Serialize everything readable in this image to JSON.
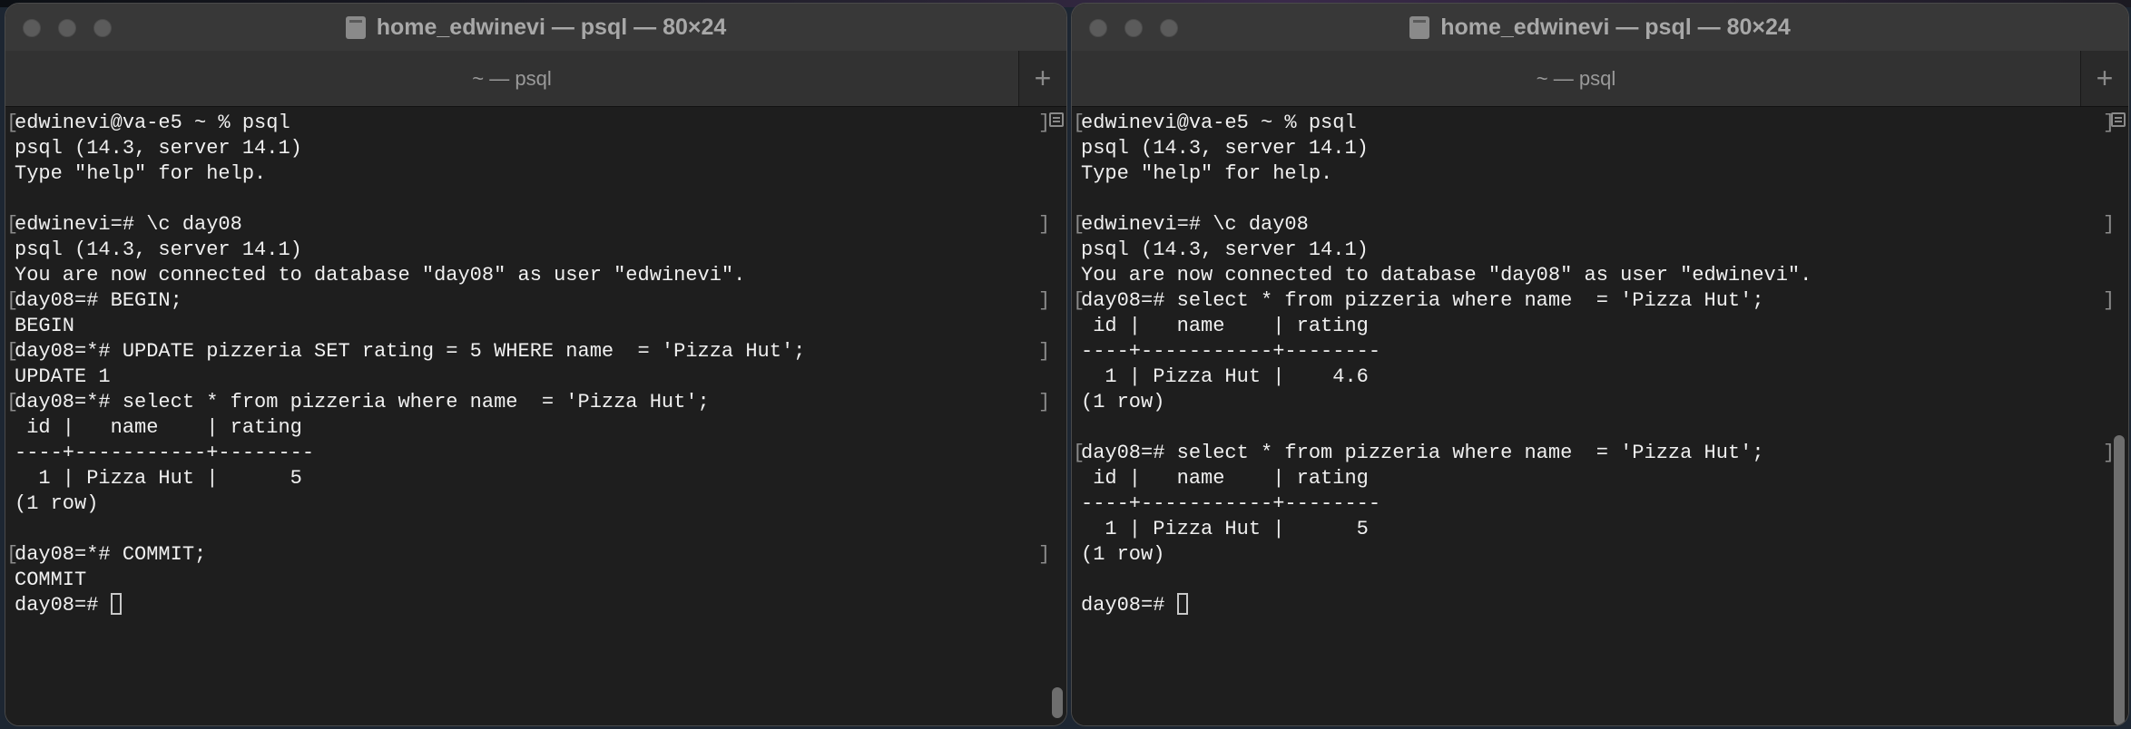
{
  "windows": [
    {
      "title": "home_edwinevi — psql — 80×24",
      "tab": "~ — psql",
      "tab_add": "+",
      "lines": [
        {
          "text": "edwinevi@va-e5 ~ % psql",
          "mark": true
        },
        {
          "text": "psql (14.3, server 14.1)",
          "mark": false
        },
        {
          "text": "Type \"help\" for help.",
          "mark": false
        },
        {
          "text": "",
          "mark": false
        },
        {
          "text": "edwinevi=# \\c day08",
          "mark": true
        },
        {
          "text": "psql (14.3, server 14.1)",
          "mark": false
        },
        {
          "text": "You are now connected to database \"day08\" as user \"edwinevi\".",
          "mark": false
        },
        {
          "text": "day08=# BEGIN;",
          "mark": true
        },
        {
          "text": "BEGIN",
          "mark": false
        },
        {
          "text": "day08=*# UPDATE pizzeria SET rating = 5 WHERE name  = 'Pizza Hut';",
          "mark": true
        },
        {
          "text": "UPDATE 1",
          "mark": false
        },
        {
          "text": "day08=*# select * from pizzeria where name  = 'Pizza Hut';",
          "mark": true
        },
        {
          "text": " id |   name    | rating",
          "mark": false
        },
        {
          "text": "----+-----------+--------",
          "mark": false
        },
        {
          "text": "  1 | Pizza Hut |      5",
          "mark": false
        },
        {
          "text": "(1 row)",
          "mark": false
        },
        {
          "text": "",
          "mark": false
        },
        {
          "text": "day08=*# COMMIT;",
          "mark": true
        },
        {
          "text": "COMMIT",
          "mark": false
        },
        {
          "text": "day08=# ",
          "mark": false,
          "cursor": true
        }
      ]
    },
    {
      "title": "home_edwinevi — psql — 80×24",
      "tab": "~ — psql",
      "tab_add": "+",
      "lines": [
        {
          "text": "edwinevi@va-e5 ~ % psql",
          "mark": true
        },
        {
          "text": "psql (14.3, server 14.1)",
          "mark": false
        },
        {
          "text": "Type \"help\" for help.",
          "mark": false
        },
        {
          "text": "",
          "mark": false
        },
        {
          "text": "edwinevi=# \\c day08",
          "mark": true
        },
        {
          "text": "psql (14.3, server 14.1)",
          "mark": false
        },
        {
          "text": "You are now connected to database \"day08\" as user \"edwinevi\".",
          "mark": false
        },
        {
          "text": "day08=# select * from pizzeria where name  = 'Pizza Hut';",
          "mark": true
        },
        {
          "text": " id |   name    | rating",
          "mark": false
        },
        {
          "text": "----+-----------+--------",
          "mark": false
        },
        {
          "text": "  1 | Pizza Hut |    4.6",
          "mark": false
        },
        {
          "text": "(1 row)",
          "mark": false
        },
        {
          "text": "",
          "mark": false
        },
        {
          "text": "day08=# select * from pizzeria where name  = 'Pizza Hut';",
          "mark": true
        },
        {
          "text": " id |   name    | rating",
          "mark": false
        },
        {
          "text": "----+-----------+--------",
          "mark": false
        },
        {
          "text": "  1 | Pizza Hut |      5",
          "mark": false
        },
        {
          "text": "(1 row)",
          "mark": false
        },
        {
          "text": "",
          "mark": false
        },
        {
          "text": "day08=# ",
          "mark": false,
          "cursor": true
        }
      ]
    }
  ]
}
